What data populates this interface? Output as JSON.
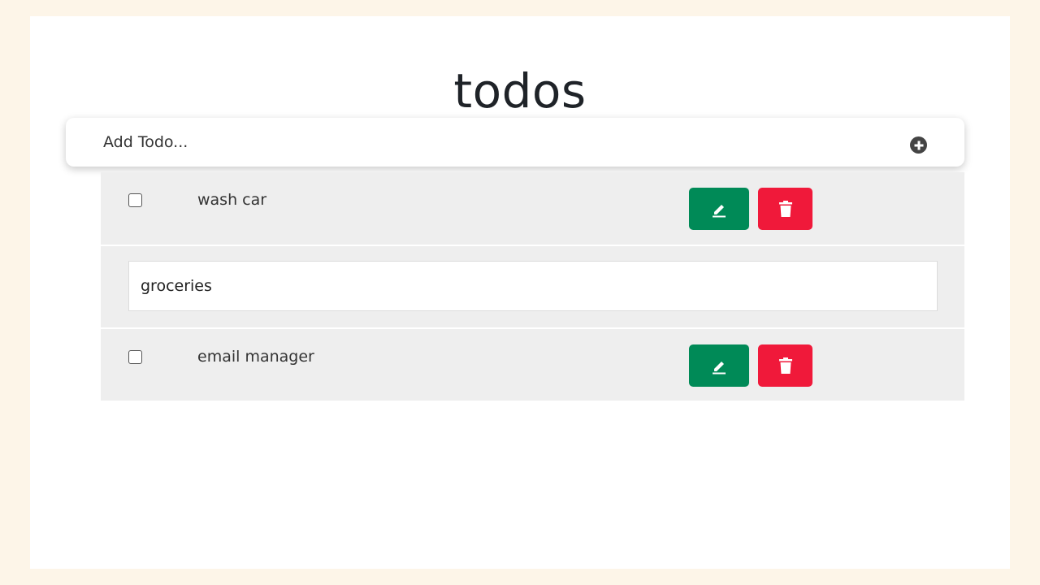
{
  "app": {
    "title": "todos"
  },
  "add_bar": {
    "placeholder": "Add Todo...",
    "add_icon": "plus-circle-icon"
  },
  "todos": [
    {
      "label": "wash car",
      "checked": false,
      "edit_icon": "pencil-icon",
      "delete_icon": "trash-icon"
    },
    {
      "editing": true,
      "value": "groceries"
    },
    {
      "label": "email manager",
      "checked": false,
      "edit_icon": "pencil-icon",
      "delete_icon": "trash-icon"
    }
  ],
  "colors": {
    "edit_button": "#008a57",
    "delete_button": "#f0193a",
    "page_background": "#fdf5e8",
    "row_background": "#eeeeee"
  }
}
